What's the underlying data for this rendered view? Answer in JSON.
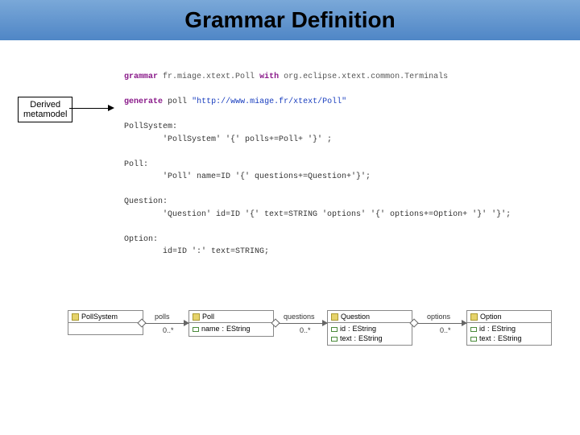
{
  "title": "Grammar Definition",
  "annotation": {
    "line1": "Derived",
    "line2": "metamodel"
  },
  "grammar": {
    "kw_grammar": "grammar",
    "pkg": "fr.miage.xtext.Poll",
    "kw_with": "with",
    "with_pkg": "org.eclipse.xtext.common.Terminals",
    "kw_generate": "generate",
    "gen_name": "poll",
    "gen_uri": "\"http://www.miage.fr/xtext/Poll\"",
    "rule_pollsystem_name": "PollSystem:",
    "rule_pollsystem_body": "        'PollSystem' '{' polls+=Poll+ '}' ;",
    "rule_poll_name": "Poll:",
    "rule_poll_body": "        'Poll' name=ID '{' questions+=Question+'}';",
    "rule_question_name": "Question:",
    "rule_question_body": "        'Question' id=ID '{' text=STRING 'options' '{' options+=Option+ '}' '}';",
    "rule_option_name": "Option:",
    "rule_option_body": "        id=ID ':' text=STRING;"
  },
  "classes": {
    "pollsystem": {
      "name": "PollSystem"
    },
    "poll": {
      "name": "Poll",
      "attr1_name": "name",
      "attr1_type": "EString"
    },
    "question": {
      "name": "Question",
      "attr1_name": "id",
      "attr1_type": "EString",
      "attr2_name": "text",
      "attr2_type": "EString"
    },
    "option": {
      "name": "Option",
      "attr1_name": "id",
      "attr1_type": "EString",
      "attr2_name": "text",
      "attr2_type": "EString"
    }
  },
  "relations": {
    "polls": {
      "label": "polls",
      "mult": "0..*"
    },
    "questions": {
      "label": "questions",
      "mult": "0..*"
    },
    "options": {
      "label": "options",
      "mult": "0..*"
    }
  }
}
